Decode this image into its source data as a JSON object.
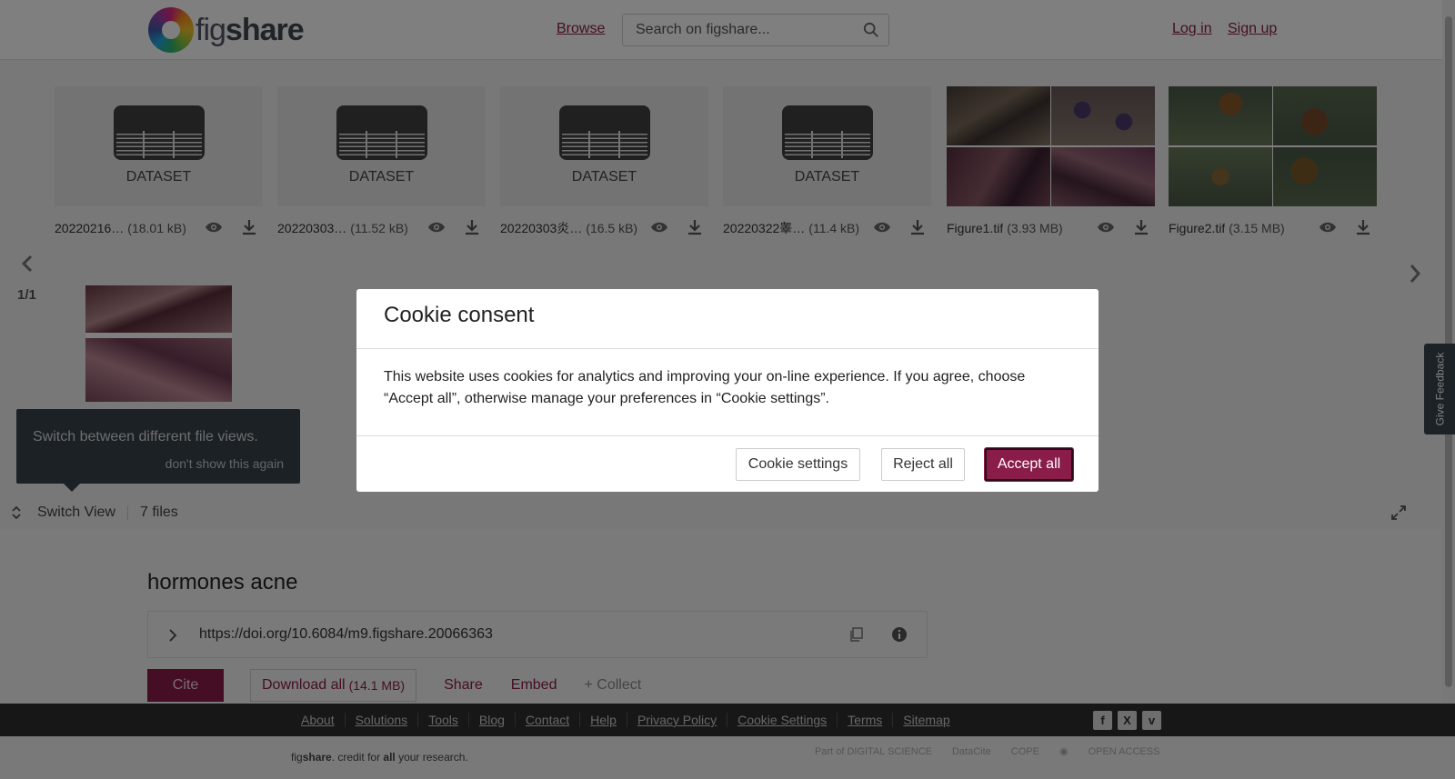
{
  "header": {
    "logo_prefix": "fig",
    "logo_suffix": "share",
    "browse": "Browse",
    "search_placeholder": "Search on figshare...",
    "login": "Log in",
    "signup": "Sign up"
  },
  "files": [
    {
      "type": "dataset",
      "thumb_label": "DATASET",
      "name": "20220216…",
      "size": "(18.01 kB)"
    },
    {
      "type": "dataset",
      "thumb_label": "DATASET",
      "name": "20220303…",
      "size": "(11.52 kB)"
    },
    {
      "type": "dataset",
      "thumb_label": "DATASET",
      "name": "20220303炎…",
      "size": "(16.5 kB)"
    },
    {
      "type": "dataset",
      "thumb_label": "DATASET",
      "name": "20220322睾…",
      "size": "(11.4 kB)"
    },
    {
      "type": "image",
      "name": "Figure1.tif",
      "size": "(3.93 MB)"
    },
    {
      "type": "image",
      "name": "Figure2.tif",
      "size": "(3.15 MB)"
    }
  ],
  "viewer": {
    "page_count": "1/1",
    "tooltip_text": "Switch between different file views.",
    "tooltip_link": "don't show this again",
    "switch_view": "Switch View",
    "file_count": "7 files"
  },
  "article": {
    "title": "hormones acne",
    "doi": "https://doi.org/10.6084/m9.figshare.20066363",
    "cite": "Cite",
    "download_all": "Download all",
    "download_size": "(14.1 MB)",
    "share": "Share",
    "embed": "Embed",
    "collect": "+ Collect"
  },
  "feedback": "Give Feedback",
  "footer": {
    "links": [
      "About",
      "Solutions",
      "Tools",
      "Blog",
      "Contact",
      "Help",
      "Privacy Policy",
      "Cookie Settings",
      "Terms",
      "Sitemap"
    ],
    "tagline_fig": "fig",
    "tagline_share": "share",
    "tagline_mid": ". credit for ",
    "tagline_all": "all",
    "tagline_end": " your research.",
    "partners": [
      "Part of DIGITAL SCIENCE",
      "DataCite",
      "COPE",
      "OPEN ACCESS"
    ]
  },
  "cookie": {
    "title": "Cookie consent",
    "body": "This website uses cookies for analytics and improving your on-line experience. If you agree, choose “Accept all”, otherwise manage your preferences in “Cookie settings”.",
    "settings": "Cookie settings",
    "reject": "Reject all",
    "accept": "Accept all"
  },
  "colors": {
    "brand": "#8a1c4a",
    "footer_bg": "#2f2f2f",
    "tooltip_bg": "#39434a"
  }
}
